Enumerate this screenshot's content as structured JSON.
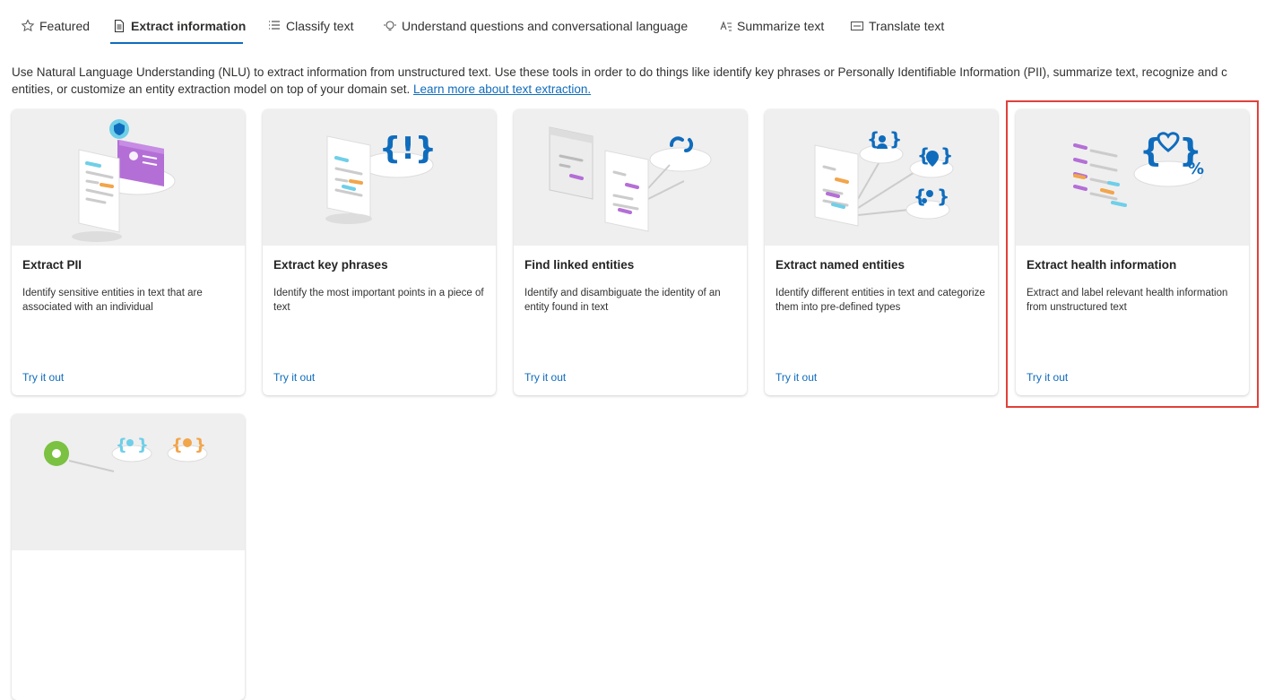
{
  "tabs": [
    {
      "label": "Featured",
      "icon": "star-icon"
    },
    {
      "label": "Extract information",
      "icon": "document-icon",
      "active": true
    },
    {
      "label": "Classify text",
      "icon": "list-icon"
    },
    {
      "label": "Understand questions and conversational language",
      "icon": "chat-bulb-icon"
    },
    {
      "label": "Summarize text",
      "icon": "summarize-icon"
    },
    {
      "label": "Translate text",
      "icon": "translate-icon"
    }
  ],
  "intro": {
    "line1": "Use Natural Language Understanding (NLU) to extract information from unstructured text. Use these tools in order to do things like identify key phrases or Personally Identifiable Information (PII), summarize text, recognize and c",
    "line2": "entities, or customize an entity extraction model on top of your domain set.",
    "link": "Learn more about text extraction."
  },
  "cards": [
    {
      "title": "Extract PII",
      "description": "Identify sensitive entities in text that are associated with an individual",
      "action": "Try it out"
    },
    {
      "title": "Extract key phrases",
      "description": "Identify the most important points in a piece of text",
      "action": "Try it out"
    },
    {
      "title": "Find linked entities",
      "description": "Identify and disambiguate the identity of an entity found in text",
      "action": "Try it out"
    },
    {
      "title": "Extract named entities",
      "description": "Identify different entities in text and categorize them into pre-defined types",
      "action": "Try it out"
    },
    {
      "title": "Extract health information",
      "description": "Extract and label relevant health information from unstructured text",
      "action": "Try it out",
      "highlighted": true
    }
  ],
  "colors": {
    "accent": "#0f6cbd",
    "highlight": "#e0413a",
    "purple": "#b46fd6",
    "orange": "#f2a54a",
    "cyan": "#6fcfe8"
  }
}
